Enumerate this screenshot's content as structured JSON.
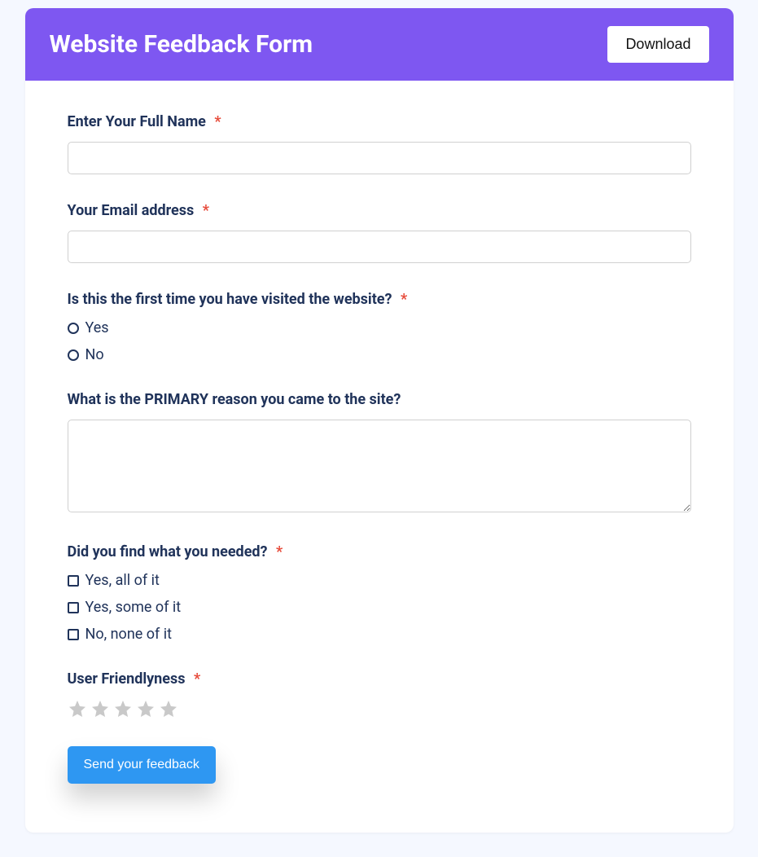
{
  "header": {
    "title": "Website Feedback Form",
    "download_label": "Download"
  },
  "fields": {
    "full_name": {
      "label": "Enter Your Full Name",
      "required": true
    },
    "email": {
      "label": "Your Email address",
      "required": true
    },
    "first_visit": {
      "label": "Is this the first time you have visited the website?",
      "required": true,
      "options": [
        "Yes",
        "No"
      ]
    },
    "primary_reason": {
      "label": "What is the PRIMARY reason you came to the site?",
      "required": false
    },
    "found_needed": {
      "label": "Did you find what you needed?",
      "required": true,
      "options": [
        "Yes, all of it",
        "Yes, some of it",
        "No, none of it"
      ]
    },
    "user_friendliness": {
      "label": "User Friendlyness",
      "required": true,
      "stars": 5
    }
  },
  "submit_label": "Send your feedback",
  "required_marker": "*"
}
